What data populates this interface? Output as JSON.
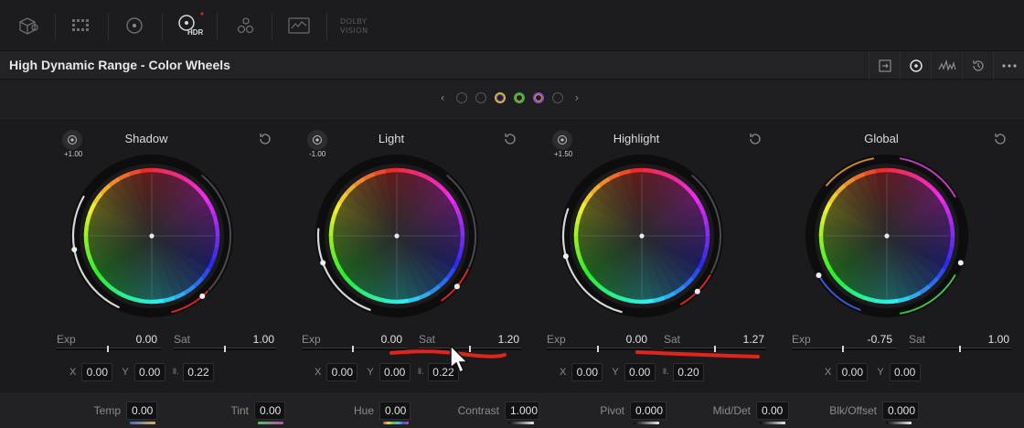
{
  "toolbar": {
    "tools": [
      {
        "name": "3d-cube-icon"
      },
      {
        "name": "grid-icon"
      },
      {
        "name": "target-icon"
      },
      {
        "name": "hdr-icon",
        "label": "HDR"
      },
      {
        "name": "nodes-icon"
      },
      {
        "name": "scope-icon"
      }
    ],
    "dolby_line1": "DOLBY",
    "dolby_line2": "VISION"
  },
  "header": {
    "title": "High Dynamic Range - Color Wheels",
    "icons": [
      "panel-expand-icon",
      "wheel-mode-icon",
      "waveform-icon",
      "history-icon",
      "more-options-icon"
    ]
  },
  "pager": {
    "prev": "‹",
    "next": "›",
    "dots": [
      {
        "color": "#555559"
      },
      {
        "color": "#555559"
      },
      {
        "color": "#c2b53a"
      },
      {
        "color": "#b8a43a"
      },
      {
        "color": "#8d49c4"
      },
      {
        "color": "#555559"
      }
    ]
  },
  "wheels": [
    {
      "title": "Shadow",
      "mode_value": "+1.00",
      "exp_label": "Exp",
      "exp_value": "0.00",
      "sat_label": "Sat",
      "sat_value": "1.00",
      "x_label": "X",
      "x_value": "0.00",
      "y_label": "Y",
      "y_value": "0.00",
      "lum_value": "0.22"
    },
    {
      "title": "Light",
      "mode_value": "-1.00",
      "exp_label": "Exp",
      "exp_value": "0.00",
      "sat_label": "Sat",
      "sat_value": "1.20",
      "x_label": "X",
      "x_value": "0.00",
      "y_label": "Y",
      "y_value": "0.00",
      "lum_value": "0.22"
    },
    {
      "title": "Highlight",
      "mode_value": "+1.50",
      "exp_label": "Exp",
      "exp_value": "0.00",
      "sat_label": "Sat",
      "sat_value": "1.27",
      "x_label": "X",
      "x_value": "0.00",
      "y_label": "Y",
      "y_value": "0.00",
      "lum_value": "0.20"
    },
    {
      "title": "Global",
      "exp_label": "Exp",
      "exp_value": "-0.75",
      "sat_label": "Sat",
      "sat_value": "1.00",
      "x_label": "X",
      "x_value": "0.00",
      "y_label": "Y",
      "y_value": "0.00"
    }
  ],
  "bottom": {
    "params": [
      {
        "label": "Temp",
        "value": "0.00",
        "bar": "temp"
      },
      {
        "label": "Tint",
        "value": "0.00",
        "bar": "tint"
      },
      {
        "label": "Hue",
        "value": "0.00",
        "bar": "hue"
      },
      {
        "label": "Contrast",
        "value": "1.000",
        "bar": "gray"
      },
      {
        "label": "Pivot",
        "value": "0.000",
        "bar": "gray"
      },
      {
        "label": "Mid/Det",
        "value": "0.00",
        "bar": "gray"
      },
      {
        "label": "Blk/Offset",
        "value": "0.000",
        "bar": "gray"
      }
    ]
  },
  "colors": {
    "accent_annotation": "#e1251b",
    "panel_bg": "#1b1b1d"
  }
}
